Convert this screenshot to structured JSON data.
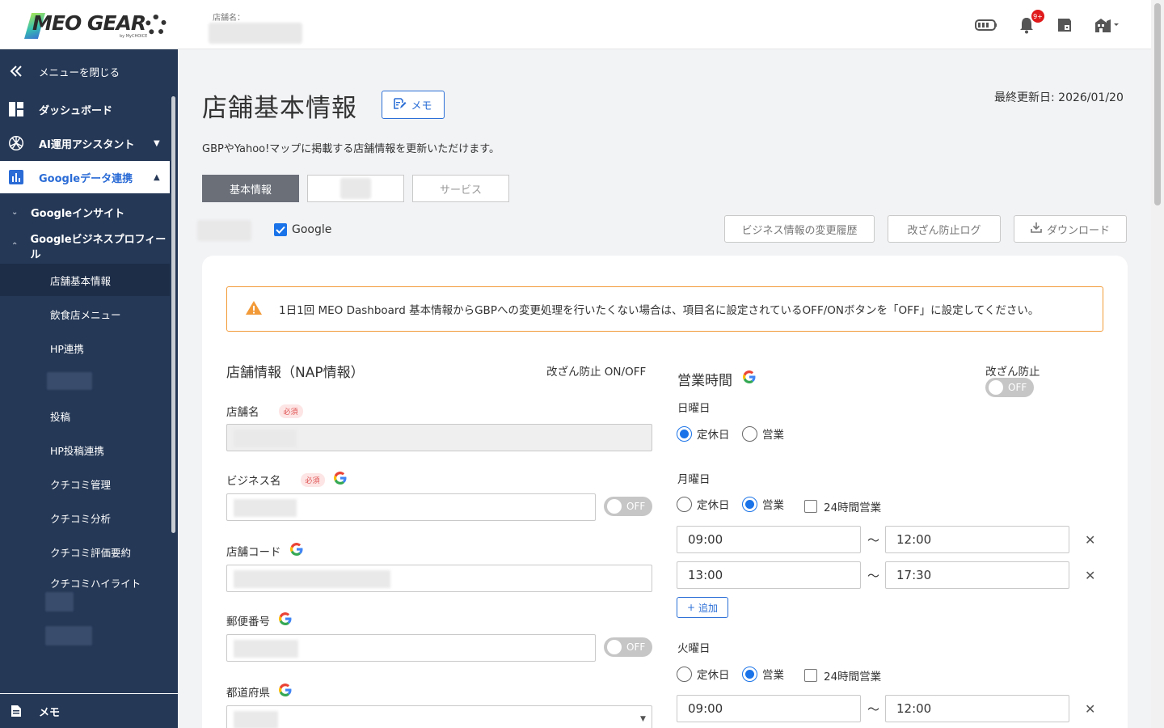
{
  "header": {
    "logo_text": "MEO GEAR",
    "logo_sub": "by MyCHOICE",
    "store_label": "店舗名：",
    "notification_count": "9+"
  },
  "sidebar": {
    "close_menu": "メニューを閉じる",
    "dashboard": "ダッシュボード",
    "ai_assistant": "AI運用アシスタント",
    "google_data": "Googleデータ連携",
    "google_insight": "Googleインサイト",
    "google_profile": "Googleビジネスプロフィール",
    "leaves": [
      "店舗基本情報",
      "飲食店メニュー",
      "HP連携",
      "投稿",
      "HP投稿連携",
      "クチコミ管理",
      "クチコミ分析",
      "クチコミ評価要約",
      "クチコミハイライト"
    ],
    "memo": "メモ"
  },
  "page": {
    "title": "店舗基本情報",
    "memo_button": "メモ",
    "last_updated": "最終更新日: 2026/01/20",
    "description": "GBPやYahoo!マップに掲載する店舗情報を更新いただけます。",
    "tabs": [
      "基本情報",
      "",
      "サービス"
    ],
    "google_checkbox": "Google",
    "history_button": "ビジネス情報の変更履歴",
    "tamper_log_button": "改ざん防止ログ",
    "download_button": "ダウンロード",
    "warning": "1日1回 MEO Dashboard 基本情報からGBPへの変更処理を行いたくない場合は、項目名に設定されているOFF/ONボタンを「OFF」に設定してください。"
  },
  "nap": {
    "title": "店舗情報（NAP情報）",
    "tamper_toggle_label": "改ざん防止 ON/OFF",
    "required": "必須",
    "fields": {
      "store_name": "店舗名",
      "business_name": "ビジネス名",
      "store_code": "店舗コード",
      "postal_code": "郵便番号",
      "prefecture": "都道府県"
    },
    "off": "OFF"
  },
  "hours": {
    "title": "営業時間",
    "tamper_label": "改ざん防止",
    "tamper_state": "OFF",
    "closed": "定休日",
    "open": "営業",
    "h24": "24時間営業",
    "tilde": "〜",
    "add": "追加",
    "days": {
      "sun": "日曜日",
      "mon": "月曜日",
      "tue": "火曜日"
    },
    "mon_slots": [
      {
        "start": "09:00",
        "end": "12:00"
      },
      {
        "start": "13:00",
        "end": "17:30"
      }
    ],
    "tue_slots": [
      {
        "start": "09:00",
        "end": "12:00"
      }
    ]
  },
  "colors": {
    "sidebar_bg": "#253856",
    "accent": "#2c6fd6",
    "warning_border": "#f29a38",
    "badge": "#e0191b"
  }
}
